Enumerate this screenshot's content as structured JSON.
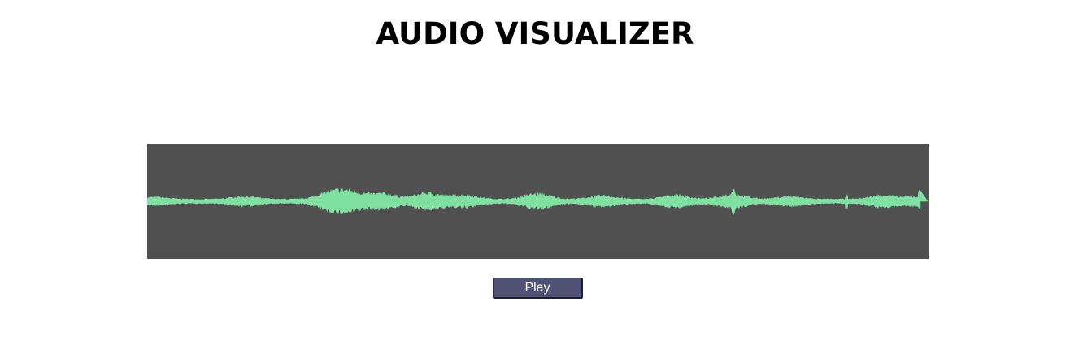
{
  "page": {
    "title": "AUDIO VISUALIZER"
  },
  "waveform": {
    "background_color": "#505050",
    "wave_color": "#7fe0a2"
  },
  "controls": {
    "play_label": "Play",
    "button_color": "#4f5274"
  }
}
